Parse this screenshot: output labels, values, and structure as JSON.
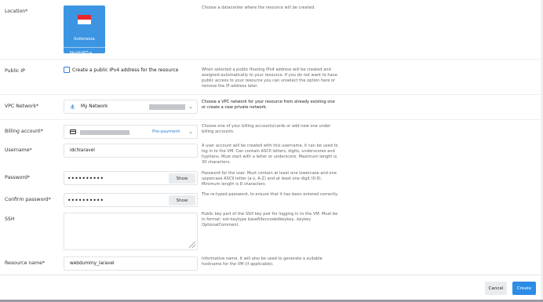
{
  "location": {
    "label": "Location*",
    "card_name": "Indonesia",
    "zone": "NorthJKT-a",
    "help": "Choose a datacenter where the resource will be created."
  },
  "public_ip": {
    "label": "Public IP",
    "checkbox_label": "Create a public IPv4 address for the resource",
    "checked": false,
    "help": "When selected a public floating IPv4 address will be created and assigned automatically to your resource. If you do not want to have public access to your resource you can unselect the option here or remove the IP address later."
  },
  "vpc": {
    "label": "VPC Network*",
    "value": "My Network",
    "help": "Choose a VPC network for your resource from already existing one or create a new private network."
  },
  "billing": {
    "label": "Billing account*",
    "badge": "Pre-payment",
    "help": "Choose one of your billing accounts/cards or add new one under billing accounts."
  },
  "username": {
    "label": "Username*",
    "value": "idchlaravel",
    "help": "A user account will be created with this username, it can be used to log in to the VM. Can contain ASCII letters, digits, underscores and hyphens. Must start with a letter or underscore. Maximum length is 30 characters."
  },
  "password": {
    "label": "Password*",
    "value": "••••••••••",
    "show_label": "Show",
    "help": "Password for the user. Must contain at least one lowercase and one uppercase ASCII letter (a-z, A-Z) and at least one digit (0-9). Minimum length is 8 characters."
  },
  "confirm_password": {
    "label": "Confirm password*",
    "value": "••••••••••",
    "show_label": "Show",
    "help": "The re-typed password, to ensure that it has been entered correctly."
  },
  "ssh": {
    "label": "SSH",
    "value": "",
    "help": "Public key part of the SSH key pair for logging in to the VM. Must be in format: ssh-keytype base64encodedkeykey...keykey OptionalComment."
  },
  "resource_name": {
    "label": "Resource name*",
    "value": "webdummy_laravel",
    "help": "Informative name, it will also be used to generate a suitable hostname for the VM (if applicable)."
  },
  "footer": {
    "cancel_label": "Cancel",
    "create_label": "Create"
  },
  "icons": {
    "vpc": "network-icon",
    "billing": "credit-card-icon",
    "chevron": "chevron-down-icon"
  },
  "colors": {
    "accent": "#2d8ce6",
    "location_card": "#3b95e2",
    "flag_red": "#e8272c"
  }
}
